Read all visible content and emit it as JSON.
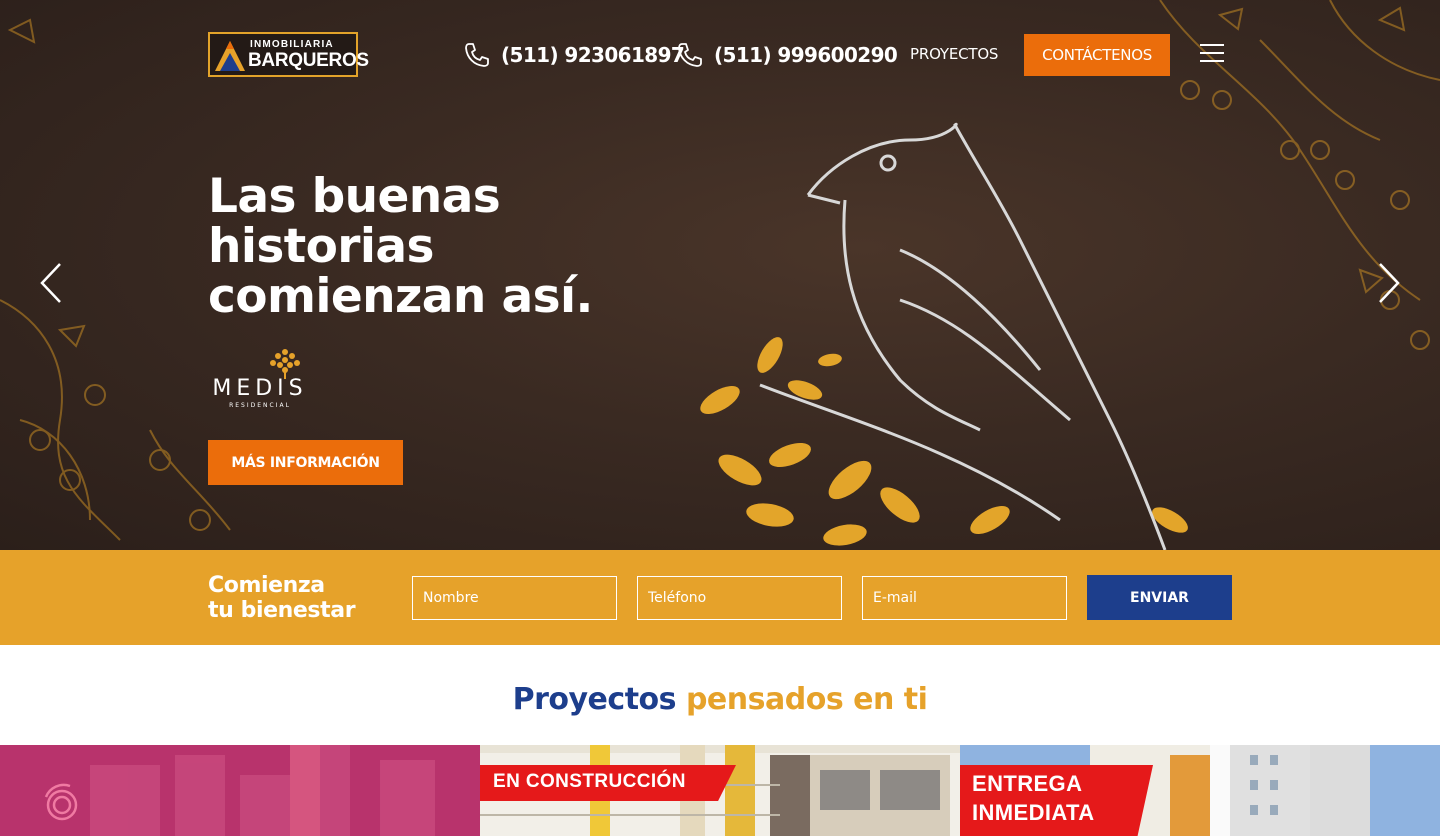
{
  "brand": {
    "logo_top": "INMOBILIARIA",
    "logo_main": "BARQUEROS"
  },
  "header": {
    "phone_1": "(511) 923061897",
    "phone_2": "(511) 999600290",
    "nav_projects": "PROYECTOS",
    "contact_label": "CONTÁCTENOS",
    "menu_icon": "hamburger-icon"
  },
  "hero": {
    "headline": "Las buenas historias comienzan así.",
    "project_logo_name": "MEDIS",
    "project_logo_sub": "RESIDENCIAL",
    "cta_label": "MÁS INFORMACIÓN",
    "prev_icon": "chevron-left-icon",
    "next_icon": "chevron-right-icon"
  },
  "lead_form": {
    "title_line1": "Comienza",
    "title_line2": "tu bienestar",
    "name_placeholder": "Nombre",
    "phone_placeholder": "Teléfono",
    "email_placeholder": "E-mail",
    "submit_label": "ENVIAR"
  },
  "projects": {
    "title_part1": "Proyectos",
    "title_part2": "pensados en ti",
    "cards": [
      {
        "tag": ""
      },
      {
        "tag": "EN CONSTRUCCIÓN"
      },
      {
        "tag_line1": "ENTREGA",
        "tag_line2": "INMEDIATA"
      }
    ]
  },
  "colors": {
    "orange": "#eb6d0b",
    "gold": "#e6a22a",
    "navy": "#1d3e8c",
    "hero_bg": "#3a2a22",
    "tag_red": "#e5191a"
  }
}
